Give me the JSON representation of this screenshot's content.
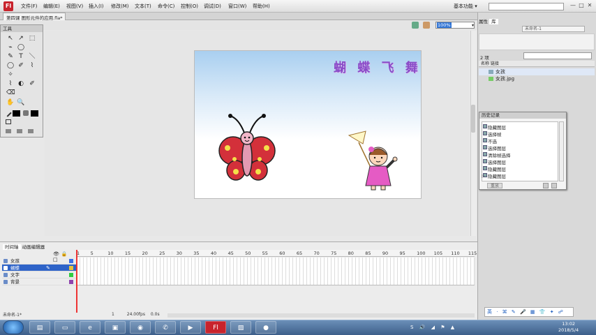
{
  "app": {
    "logo": "Fl",
    "workspace": "基本功能 ▾"
  },
  "menu": [
    "文件(F)",
    "编辑(E)",
    "视图(V)",
    "插入(I)",
    "修改(M)",
    "文本(T)",
    "命令(C)",
    "控制(O)",
    "调试(D)",
    "窗口(W)",
    "帮助(H)"
  ],
  "window_controls": [
    "—",
    "□",
    "✕"
  ],
  "document": {
    "tab": "第四课 图形元件的应用.fla*",
    "zoom": "100%"
  },
  "stage": {
    "title": "蝴 蝶 飞 舞",
    "colors": {
      "sky": "#a9cff0",
      "title": "#8a4cc8",
      "wing": "#d3303a",
      "dress": "#e55bc4"
    }
  },
  "tools": {
    "header": "工具",
    "glyphs": [
      "↖",
      "↗",
      "⬚",
      "⌁",
      "◯",
      "T",
      "＼",
      "◯",
      "✎",
      "⌇",
      "✐",
      "◐",
      "✧",
      "⌫",
      "✋",
      "🔍",
      "■",
      "■"
    ]
  },
  "timeline": {
    "tabs": [
      "时间轴",
      "动画编辑器"
    ],
    "ruler": [
      "1",
      "5",
      "10",
      "15",
      "20",
      "25",
      "30",
      "35",
      "40",
      "45",
      "50",
      "55",
      "60",
      "65",
      "70",
      "75",
      "80",
      "85",
      "90",
      "95",
      "100",
      "105",
      "110",
      "115"
    ],
    "layers": [
      {
        "name": "女孩",
        "color": "#3a6ee8",
        "selected": false
      },
      {
        "name": "蝴蝶",
        "color": "#e8c23a",
        "selected": true
      },
      {
        "name": "文字",
        "color": "#2ecc40",
        "selected": false
      },
      {
        "name": "背景",
        "color": "#8e44ad",
        "selected": false
      }
    ],
    "bottom": {
      "frame": "1",
      "fps": "24.00fps",
      "time": "0.0s"
    }
  },
  "right_panel": {
    "tabs": [
      "属性",
      "库"
    ],
    "library_doc": "未命名-1",
    "count": "2 项",
    "headers": "名称                                   链接",
    "items": [
      "女孩",
      "女孩.jpg"
    ]
  },
  "history": {
    "title": "历史记录",
    "items": [
      "隐藏图层",
      "选择帧",
      "不选",
      "选择图层",
      "清除帧选择",
      "选择图层",
      "隐藏图层",
      "隐藏图层"
    ],
    "replay": "重放"
  },
  "statusbar": "未命名-1*",
  "taskbar": {
    "clock_time": "13:02",
    "clock_date": "2018/5/4",
    "ime": "英 · ⌘ ✎ 🎤 ▦ 👕 ✦ ☍",
    "tray": "S 🔊 ◢ ⚑ ▲"
  }
}
